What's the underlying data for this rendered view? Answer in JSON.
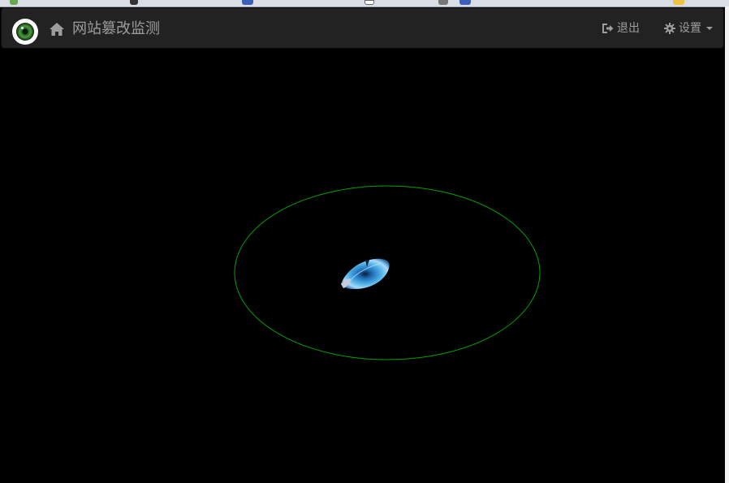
{
  "navbar": {
    "title": "网站篡改监测",
    "logout_label": "退出",
    "settings_label": "设置",
    "bg_color": "#222222",
    "text_color": "#9d9d9d"
  },
  "stage": {
    "bg_color": "#000000",
    "ring_color": "#00a000"
  },
  "icons": {
    "brand": "eye-logo-icon",
    "home": "home-icon",
    "logout": "sign-out-icon",
    "settings": "gear-icon",
    "dropdown": "caret-down-icon",
    "center": "eye-icon"
  }
}
